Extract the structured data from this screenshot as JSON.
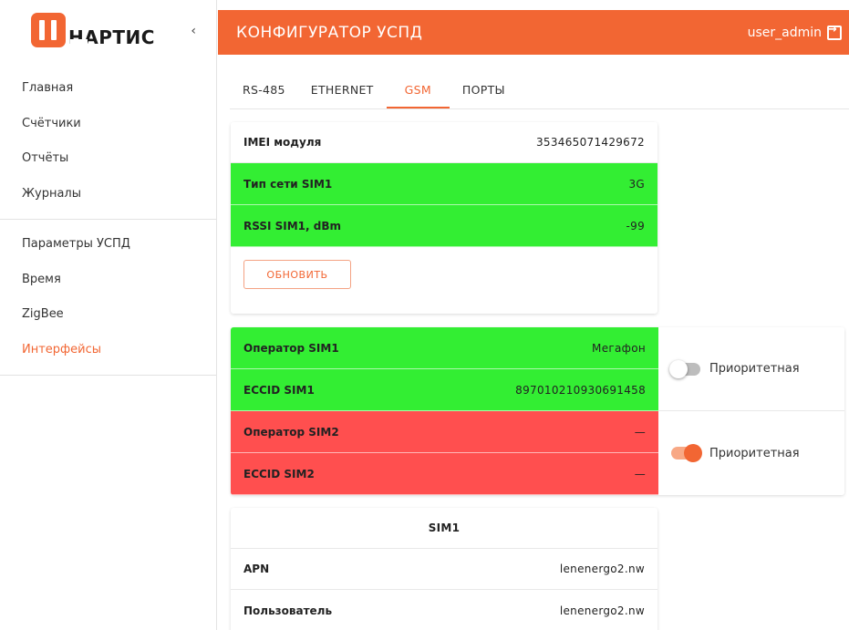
{
  "brand": {
    "logo_text": "НАРТИС",
    "collapse_glyph": "‹"
  },
  "sidebar": {
    "group1": [
      {
        "label": "Главная",
        "active": false
      },
      {
        "label": "Счётчики",
        "active": false
      },
      {
        "label": "Отчёты",
        "active": false
      },
      {
        "label": "Журналы",
        "active": false
      }
    ],
    "group2": [
      {
        "label": "Параметры УСПД",
        "active": false
      },
      {
        "label": "Время",
        "active": false
      },
      {
        "label": "ZigBee",
        "active": false
      },
      {
        "label": "Интерфейсы",
        "active": true
      }
    ]
  },
  "header": {
    "title": "КОНФИГУРАТОР УСПД",
    "user": "user_admin"
  },
  "tabs": [
    {
      "label": "RS-485",
      "active": false
    },
    {
      "label": "ETHERNET",
      "active": false
    },
    {
      "label": "GSM",
      "active": true
    },
    {
      "label": "ПОРТЫ",
      "active": false
    }
  ],
  "module": {
    "imei_label": "IMEI модуля",
    "imei_value": "353465071429672",
    "net_label": "Тип сети SIM1",
    "net_value": "3G",
    "rssi_label": "RSSI SIM1, dBm",
    "rssi_value": "-99",
    "refresh_label": "ОБНОВИТЬ"
  },
  "sims": {
    "sim1": {
      "operator_label": "Оператор SIM1",
      "operator_value": "Мегафон",
      "iccid_label": "ECCID SIM1",
      "iccid_value": "897010210930691458",
      "priority_label": "Приоритетная",
      "priority": false
    },
    "sim2": {
      "operator_label": "Оператор SIM2",
      "operator_value": "—",
      "iccid_label": "ECCID SIM2",
      "iccid_value": "—",
      "priority_label": "Приоритетная",
      "priority": true
    }
  },
  "sim1_settings": {
    "title": "SIM1",
    "apn_label": "APN",
    "apn_value": "lenenergo2.nw",
    "user_label": "Пользователь",
    "user_value": "lenenergo2.nw"
  },
  "colors": {
    "accent": "#f26633",
    "ok": "#33ee33",
    "error": "#ff4f4f"
  }
}
